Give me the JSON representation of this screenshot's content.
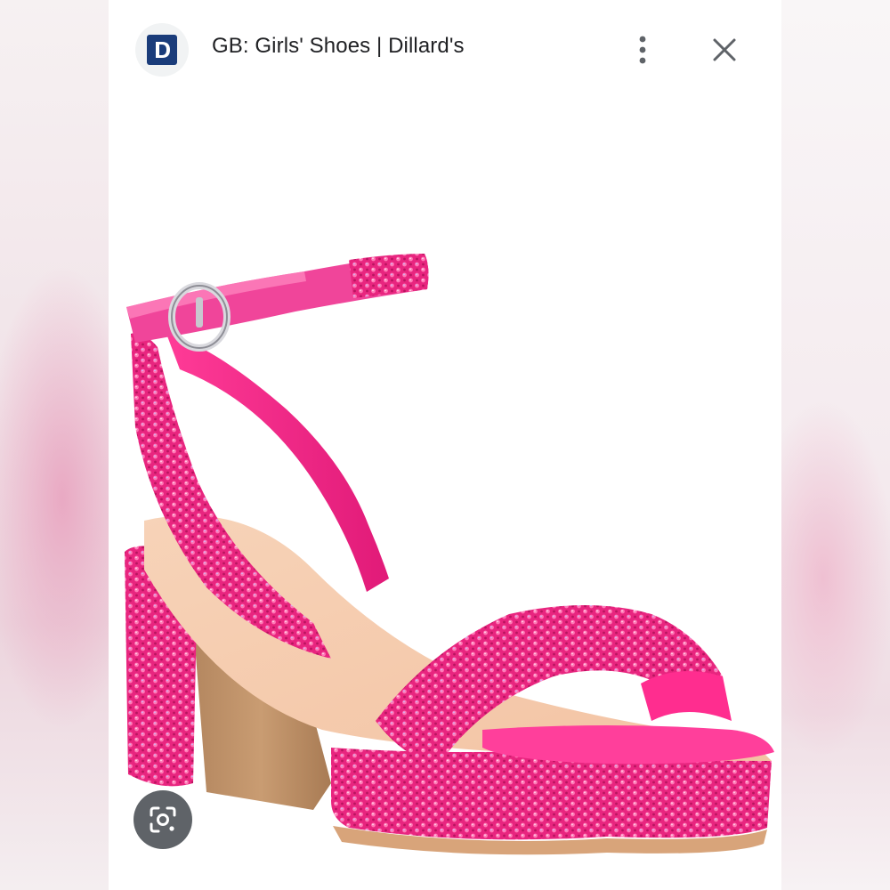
{
  "header": {
    "site_logo_letter": "D",
    "title": "GB: Girls' Shoes | Dillard's"
  },
  "icons": {
    "site_logo": "dillards-logo-icon",
    "more": "more-vert-icon",
    "close": "close-icon",
    "lens": "google-lens-icon"
  },
  "colors": {
    "logo_navy": "#1a3c7a",
    "shoe_pink": "#e8257f",
    "lens_button": "#5f6368"
  }
}
